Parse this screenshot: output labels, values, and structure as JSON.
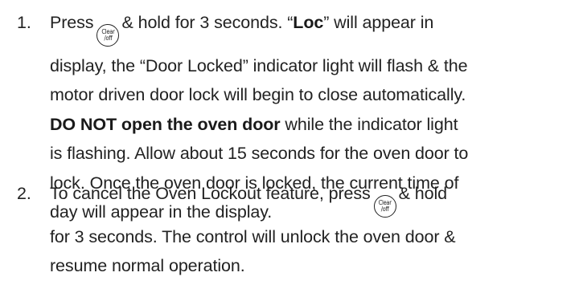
{
  "steps": [
    {
      "number": "1.",
      "lines": {
        "l1_a": "Press",
        "l1_b": "& hold for 3 seconds. “",
        "l1_bold": "Loc",
        "l1_c": "” will appear in",
        "l2": "display, the “Door Locked” indicator light will flash & the",
        "l3": "motor driven door lock will begin to close automatically.",
        "l4_bold": "DO NOT open the oven door",
        "l4_rest": " while the indicator light",
        "l5": "is flashing. Allow about 15 seconds for the oven door to",
        "l6": "lock. Once the oven door is locked, the current time of",
        "l7": "day will appear in the display."
      }
    },
    {
      "number": "2.",
      "lines": {
        "l1_a": "To cancel the Oven Lockout feature, press",
        "l1_b": "& hold",
        "l2": "for 3 seconds. The control will unlock the oven door &",
        "l3": "resume normal operation."
      }
    }
  ],
  "clear_off_button": {
    "icon": "clear-off-button-icon",
    "top_text": "Clear",
    "bottom_text": "/off"
  }
}
